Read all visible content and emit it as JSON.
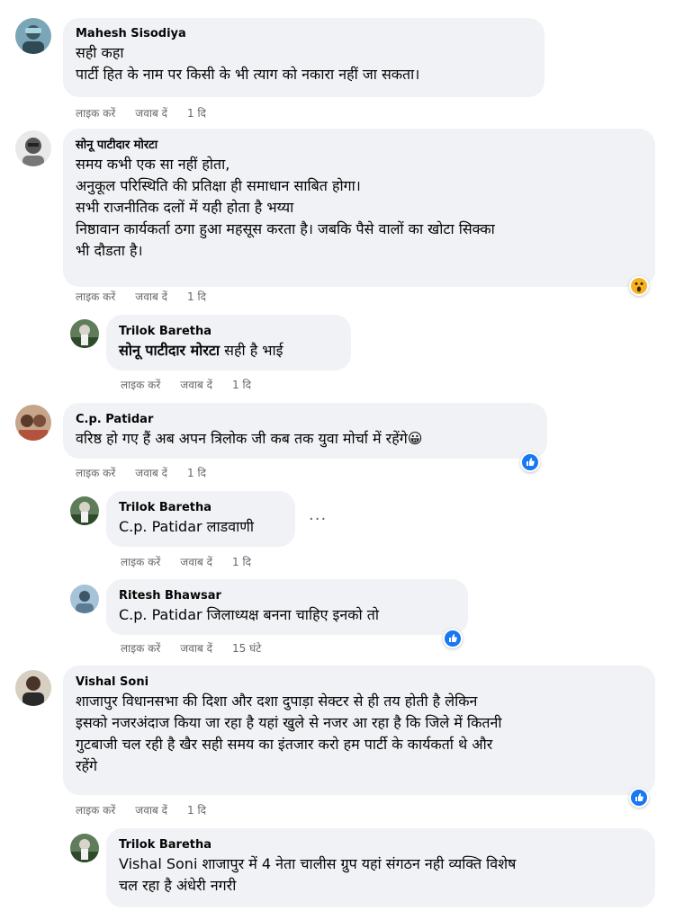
{
  "actions": {
    "like": "लाइक करें",
    "reply": "जवाब दें"
  },
  "comments": [
    {
      "author": "Mahesh Sisodiya",
      "text": "सही कहा\nपार्टी हित के नाम पर किसी के भी त्याग को नकारा नहीं जा सकता।",
      "time": "1 दि"
    },
    {
      "author": "सोनू पाटीदार मोरटा",
      "text": "समय कभी एक सा नहीं होता,\nअनुकूल परिस्थिति की प्रतिक्षा ही समाधान साबित होगा।\nसभी राजनीतिक दलों में यही होता है भय्या\nनिष्ठावान कार्यकर्ता ठगा हुआ महसूस करता है। जबकि पैसे वालों का खोटा सिक्का\nभी दौडता है।",
      "time": "1 दि",
      "reaction": "wow"
    },
    {
      "author": "Trilok Baretha",
      "mention": "सोनू पाटीदार मोरटा",
      "text": " सही है भाई",
      "time": "1 दि"
    },
    {
      "author": "C.p. Patidar",
      "text": "वरिष्ठ हो गए हैं अब अपन त्रिलोक जी कब तक युवा मोर्चा में रहेंगे😀",
      "time": "1 दि",
      "reaction": "like"
    },
    {
      "author": "Trilok Baretha",
      "mention": "C.p. Patidar",
      "text": " लाडवाणी",
      "time": "1 दि",
      "more": "···"
    },
    {
      "author": "Ritesh Bhawsar",
      "mention": "C.p. Patidar",
      "text": " जिलाध्यक्ष बनना चाहिए इनको तो",
      "time": "15 घंटे",
      "reaction": "like"
    },
    {
      "author": "Vishal Soni",
      "text": "शाजापुर विधानसभा की दिशा और दशा दुपाड़ा सेक्टर से ही तय होती है लेकिन\nइसको नजरअंदाज किया जा रहा है यहां खुले से नजर आ रहा है कि जिले में कितनी\nगुटबाजी चल रही है खैर सही समय का इंतजार करो हम पार्टी के कार्यकर्ता थे और\nरहेंगे",
      "time": "1 दि",
      "reaction": "like"
    },
    {
      "author": "Trilok Baretha",
      "mention": "Vishal Soni",
      "text": " शाजापुर में 4 नेता चालीस ग्रुप यहां संगठन नही व्यक्ति विशेष\nचल रहा है अंधेरी नगरी"
    }
  ],
  "colors": {
    "bubble": "#f0f2f5",
    "meta": "#65676b",
    "like_blue": "#1877f2",
    "wow_yellow": "#f7b125"
  }
}
